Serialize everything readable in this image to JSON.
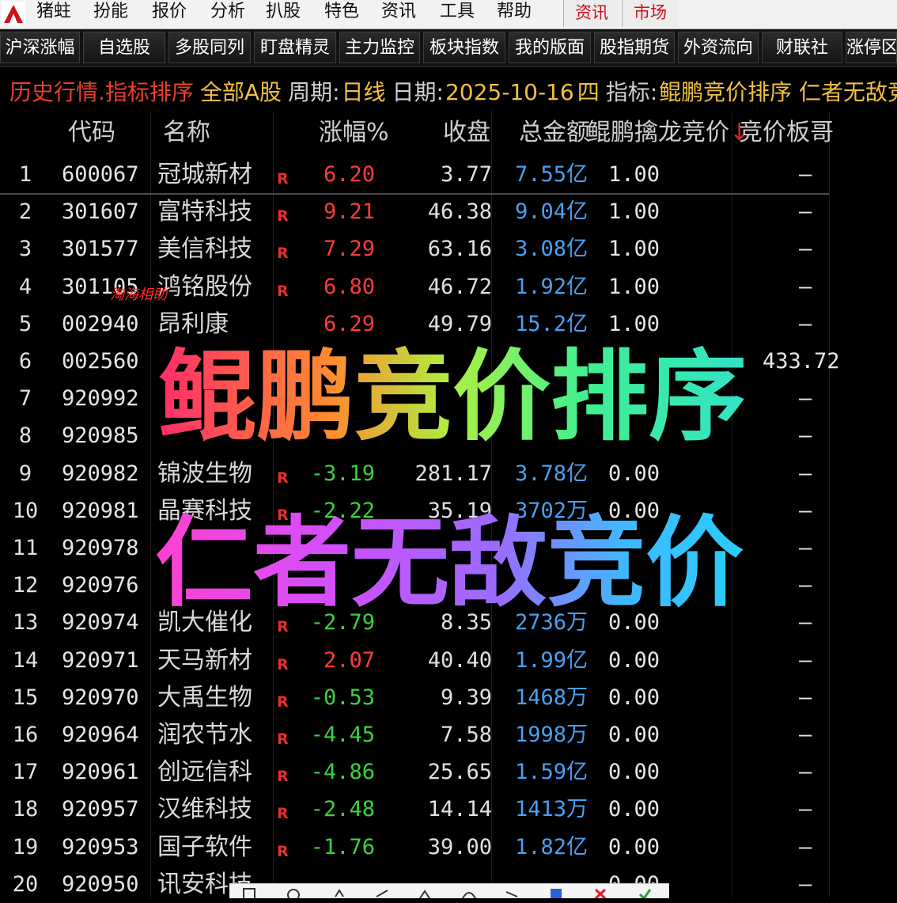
{
  "menubar": {
    "items": [
      "猪蛀",
      "扮能",
      "报价",
      "分析",
      "扒股",
      "特色",
      "资讯",
      "工具",
      "帮助"
    ],
    "special": [
      "资讯",
      "市场"
    ]
  },
  "toolbar": {
    "buttons": [
      "沪深涨幅",
      "自选股",
      "多股同列",
      "盯盘精灵",
      "主力监控",
      "板块指数",
      "我的版面",
      "股指期货",
      "外资流向",
      "财联社",
      "涨停区"
    ]
  },
  "infobar": {
    "title": "历史行情.指标排序",
    "market": "全部A股",
    "period_label": "周期:",
    "period": "日线",
    "date_label": "日期:",
    "date": "2025-10-16",
    "weekday": "四",
    "indicator_label": "指标:",
    "indicator": "鲲鹏竞价排序 仁者无敌竞价"
  },
  "table": {
    "headers": {
      "code": "代码",
      "name": "名称",
      "pct": "涨幅%",
      "close": "收盘",
      "amount": "总金额",
      "auction": "鲲鹏擒龙竞价",
      "sort_arrow": "↓",
      "boss": "竞价板哥"
    },
    "rows": [
      {
        "idx": "1",
        "code": "600067",
        "name": "冠城新材",
        "mark": "R",
        "pct": "6.20",
        "dir": "up",
        "close": "3.77",
        "amount": "7.55亿",
        "auction": "1.00",
        "boss": "–"
      },
      {
        "idx": "2",
        "code": "301607",
        "name": "富特科技",
        "mark": "R",
        "pct": "9.21",
        "dir": "up",
        "close": "46.38",
        "amount": "9.04亿",
        "auction": "1.00",
        "boss": "–"
      },
      {
        "idx": "3",
        "code": "301577",
        "name": "美信科技",
        "mark": "R",
        "pct": "7.29",
        "dir": "up",
        "close": "63.16",
        "amount": "3.08亿",
        "auction": "1.00",
        "boss": "–"
      },
      {
        "idx": "4",
        "code": "301105",
        "name": "鸿铭股份",
        "mark": "R",
        "pct": "6.80",
        "dir": "up",
        "close": "46.72",
        "amount": "1.92亿",
        "auction": "1.00",
        "boss": "–"
      },
      {
        "idx": "5",
        "code": "002940",
        "name": "昂利康",
        "mark": "",
        "pct": "6.29",
        "dir": "up",
        "close": "49.79",
        "amount": "15.2亿",
        "auction": "1.00",
        "boss": "–"
      },
      {
        "idx": "6",
        "code": "002560",
        "name": "",
        "mark": "",
        "pct": "",
        "dir": "up",
        "close": "",
        "amount": "",
        "auction": "",
        "boss": "433.72"
      },
      {
        "idx": "7",
        "code": "920992",
        "name": "",
        "mark": "",
        "pct": "",
        "dir": "up",
        "close": "",
        "amount": "",
        "auction": "",
        "boss": "–"
      },
      {
        "idx": "8",
        "code": "920985",
        "name": "",
        "mark": "",
        "pct": "",
        "dir": "up",
        "close": "",
        "amount": "",
        "auction": "",
        "boss": "–"
      },
      {
        "idx": "9",
        "code": "920982",
        "name": "锦波生物",
        "mark": "R",
        "pct": "-3.19",
        "dir": "down",
        "close": "281.17",
        "amount": "3.78亿",
        "auction": "0.00",
        "boss": "–"
      },
      {
        "idx": "10",
        "code": "920981",
        "name": "晶赛科技",
        "mark": "R",
        "pct": "-2.22",
        "dir": "down",
        "close": "35.19",
        "amount": "3702万",
        "auction": "0.00",
        "boss": "–"
      },
      {
        "idx": "11",
        "code": "920978",
        "name": "",
        "mark": "",
        "pct": "",
        "dir": "down",
        "close": "",
        "amount": "",
        "auction": "",
        "boss": "–"
      },
      {
        "idx": "12",
        "code": "920976",
        "name": "",
        "mark": "",
        "pct": "",
        "dir": "down",
        "close": "",
        "amount": "",
        "auction": "",
        "boss": "–"
      },
      {
        "idx": "13",
        "code": "920974",
        "name": "凯大催化",
        "mark": "R",
        "pct": "-2.79",
        "dir": "down",
        "close": "8.35",
        "amount": "2736万",
        "auction": "0.00",
        "boss": "–"
      },
      {
        "idx": "14",
        "code": "920971",
        "name": "天马新材",
        "mark": "R",
        "pct": "2.07",
        "dir": "up",
        "close": "40.40",
        "amount": "1.99亿",
        "auction": "0.00",
        "boss": "–"
      },
      {
        "idx": "15",
        "code": "920970",
        "name": "大禹生物",
        "mark": "R",
        "pct": "-0.53",
        "dir": "down",
        "close": "9.39",
        "amount": "1468万",
        "auction": "0.00",
        "boss": "–"
      },
      {
        "idx": "16",
        "code": "920964",
        "name": "润农节水",
        "mark": "R",
        "pct": "-4.45",
        "dir": "down",
        "close": "7.58",
        "amount": "1998万",
        "auction": "0.00",
        "boss": "–"
      },
      {
        "idx": "17",
        "code": "920961",
        "name": "创远信科",
        "mark": "R",
        "pct": "-4.86",
        "dir": "down",
        "close": "25.65",
        "amount": "1.59亿",
        "auction": "0.00",
        "boss": "–"
      },
      {
        "idx": "18",
        "code": "920957",
        "name": "汉维科技",
        "mark": "R",
        "pct": "-2.48",
        "dir": "down",
        "close": "14.14",
        "amount": "1413万",
        "auction": "0.00",
        "boss": "–"
      },
      {
        "idx": "19",
        "code": "920953",
        "name": "国子软件",
        "mark": "R",
        "pct": "-1.76",
        "dir": "down",
        "close": "39.00",
        "amount": "1.82亿",
        "auction": "0.00",
        "boss": "–"
      },
      {
        "idx": "20",
        "code": "920950",
        "name": "讯安科技",
        "mark": "",
        "pct": "",
        "dir": "down",
        "close": "",
        "amount": "",
        "auction": "0.00",
        "boss": "–"
      }
    ]
  },
  "watermark": "淘海相助",
  "overlay": {
    "line1": "鲲鹏竞价排序",
    "line2": "仁者无敌竞价"
  },
  "colors": {
    "up": "#ff3b3b",
    "down": "#3cd23c",
    "amount": "#4aa0f0",
    "title_red": "#e8402a",
    "date_gold": "#f0c040"
  },
  "icons": [
    "app-logo-icon",
    "page-icon",
    "search-icon",
    "undo-icon",
    "draw-icon",
    "save-icon",
    "close-icon",
    "check-icon"
  ]
}
